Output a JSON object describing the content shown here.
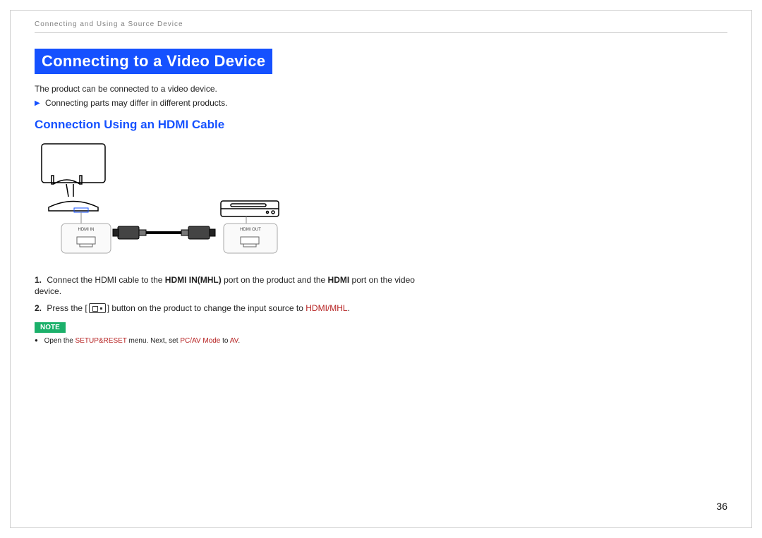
{
  "header": {
    "breadcrumb": "Connecting and Using a Source Device"
  },
  "title": "Connecting to a Video Device",
  "intro": "The product can be connected to a video device.",
  "bullet1": "Connecting parts may differ in different products.",
  "subhead": "Connection Using an HDMI Cable",
  "diagram": {
    "hdmi_in_label": "HDMI IN",
    "hdmi_out_label": "HDMI OUT"
  },
  "steps": {
    "step1": {
      "num": "1.",
      "pre": "Connect the HDMI cable to the ",
      "bold1": "HDMI IN(MHL)",
      "mid": " port on the product and the ",
      "bold2": "HDMI",
      "post": " port on the video device."
    },
    "step2": {
      "num": "2.",
      "pre": "Press the [",
      "post": "] button on the product to change the input source to ",
      "red": "HDMI/MHL",
      "tail": "."
    }
  },
  "note": {
    "tag": "NOTE",
    "pre": "Open the ",
    "red1": "SETUP&RESET",
    "mid": " menu. Next, set ",
    "red2": "PC/AV Mode",
    "mid2": " to ",
    "red3": "AV",
    "tail": "."
  },
  "page_number": "36"
}
